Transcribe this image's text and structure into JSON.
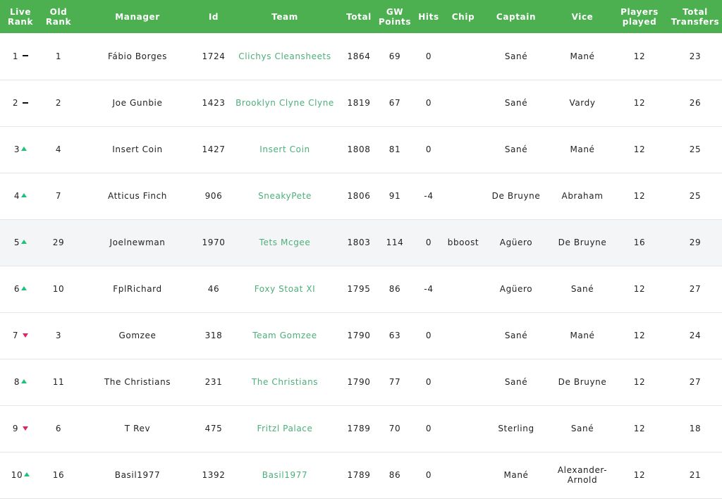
{
  "columns": [
    "Live\nRank",
    "Old\nRank",
    "Manager",
    "Id",
    "Team",
    "Total",
    "GW\nPoints",
    "Hits",
    "Chip",
    "Captain",
    "Vice",
    "Players\nplayed",
    "Total\nTransfers"
  ],
  "colors": {
    "header_bg": "#4caf50",
    "team_link": "#4caf7a",
    "up": "#19c37d",
    "down": "#e0245e",
    "same": "#111111",
    "highlight_row": "#f4f5f7"
  },
  "rows": [
    {
      "live_rank": "1",
      "movement": "same",
      "old_rank": "1",
      "manager": "Fábio Borges",
      "id": "1724",
      "team": "Clichys Cleansheets",
      "total": "1864",
      "gw_points": "69",
      "hits": "0",
      "chip": "",
      "captain": "Sané",
      "vice": "Mané",
      "players_played": "12",
      "total_transfers": "23"
    },
    {
      "live_rank": "2",
      "movement": "same",
      "old_rank": "2",
      "manager": "Joe Gunbie",
      "id": "1423",
      "team": "Brooklyn Clyne Clyne",
      "total": "1819",
      "gw_points": "67",
      "hits": "0",
      "chip": "",
      "captain": "Sané",
      "vice": "Vardy",
      "players_played": "12",
      "total_transfers": "26"
    },
    {
      "live_rank": "3",
      "movement": "up",
      "old_rank": "4",
      "manager": "Insert Coin",
      "id": "1427",
      "team": "Insert Coin",
      "total": "1808",
      "gw_points": "81",
      "hits": "0",
      "chip": "",
      "captain": "Sané",
      "vice": "Mané",
      "players_played": "12",
      "total_transfers": "25"
    },
    {
      "live_rank": "4",
      "movement": "up",
      "old_rank": "7",
      "manager": "Atticus Finch",
      "id": "906",
      "team": "SneakyPete",
      "total": "1806",
      "gw_points": "91",
      "hits": "-4",
      "chip": "",
      "captain": "De Bruyne",
      "vice": "Abraham",
      "players_played": "12",
      "total_transfers": "25"
    },
    {
      "live_rank": "5",
      "movement": "up",
      "old_rank": "29",
      "manager": "Joelnewman",
      "id": "1970",
      "team": "Tets Mcgee",
      "total": "1803",
      "gw_points": "114",
      "hits": "0",
      "chip": "bboost",
      "captain": "Agüero",
      "vice": "De Bruyne",
      "players_played": "16",
      "total_transfers": "29"
    },
    {
      "live_rank": "6",
      "movement": "up",
      "old_rank": "10",
      "manager": "FplRichard",
      "id": "46",
      "team": "Foxy Stoat XI",
      "total": "1795",
      "gw_points": "86",
      "hits": "-4",
      "chip": "",
      "captain": "Agüero",
      "vice": "Sané",
      "players_played": "12",
      "total_transfers": "27"
    },
    {
      "live_rank": "7",
      "movement": "down",
      "old_rank": "3",
      "manager": "Gomzee",
      "id": "318",
      "team": "Team Gomzee",
      "total": "1790",
      "gw_points": "63",
      "hits": "0",
      "chip": "",
      "captain": "Sané",
      "vice": "Mané",
      "players_played": "12",
      "total_transfers": "24"
    },
    {
      "live_rank": "8",
      "movement": "up",
      "old_rank": "11",
      "manager": "The Christians",
      "id": "231",
      "team": "The Christians",
      "total": "1790",
      "gw_points": "77",
      "hits": "0",
      "chip": "",
      "captain": "Sané",
      "vice": "De Bruyne",
      "players_played": "12",
      "total_transfers": "27"
    },
    {
      "live_rank": "9",
      "movement": "down",
      "old_rank": "6",
      "manager": "T Rev",
      "id": "475",
      "team": "Fritzl Palace",
      "total": "1789",
      "gw_points": "70",
      "hits": "0",
      "chip": "",
      "captain": "Sterling",
      "vice": "Sané",
      "players_played": "12",
      "total_transfers": "18"
    },
    {
      "live_rank": "10",
      "movement": "up",
      "old_rank": "16",
      "manager": "Basil1977",
      "id": "1392",
      "team": "Basil1977",
      "total": "1789",
      "gw_points": "86",
      "hits": "0",
      "chip": "",
      "captain": "Mané",
      "vice": "Alexander-\nArnold",
      "players_played": "12",
      "total_transfers": "21"
    }
  ]
}
